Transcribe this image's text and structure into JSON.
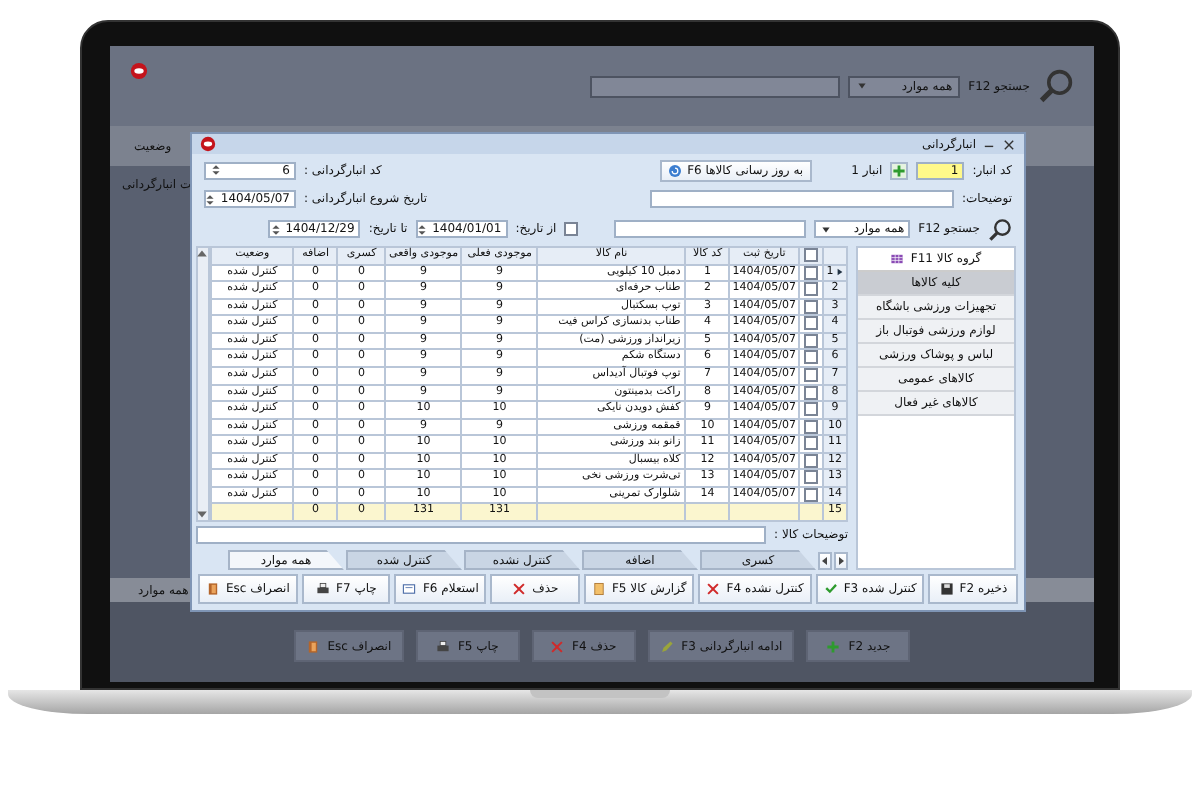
{
  "top_bar": {
    "search_label": "جستجو F12",
    "filter": "همه موارد"
  },
  "background_list": {
    "column_header": "وضعیت",
    "row": "ت انبارگردانی",
    "tab": "همه موارد"
  },
  "background_buttons": [
    {
      "kind": "new",
      "label": "جدید F2"
    },
    {
      "kind": "continue",
      "label": "ادامه انبارگردانی F3"
    },
    {
      "kind": "delete",
      "label": "حذف F4"
    },
    {
      "kind": "print",
      "label": "چاپ F5"
    },
    {
      "kind": "cancel",
      "label": "انصراف Esc"
    }
  ],
  "dialog": {
    "title": "انبارگردانی",
    "warehouse": {
      "label": "کد انبار:",
      "code": "1",
      "name": "انبار 1"
    },
    "update_button": "به روز رسانی کالاها F6",
    "count_code": {
      "label": "کد انبارگردانی :",
      "value": "6"
    },
    "description": {
      "label": "توضیحات:"
    },
    "start_date": {
      "label": "تاریخ شروع انبارگردانی :",
      "value": "1404/05/07"
    },
    "search": {
      "label": "جستجو F12",
      "filter": "همه موارد"
    },
    "date_filter": {
      "checked": false,
      "from_label": "از تاریخ:",
      "from": "1404/01/01",
      "to_label": "تا تاریخ:",
      "to": "1404/12/29"
    },
    "groups": {
      "title": "گروه کالا F11",
      "items": [
        {
          "label": "کلیه کالاها",
          "selected": true
        },
        {
          "label": "تجهیزات ورزشی باشگاه",
          "selected": false
        },
        {
          "label": "لوازم ورزشی فوتبال باز",
          "selected": false
        },
        {
          "label": "لباس و پوشاک ورزشی",
          "selected": false
        },
        {
          "label": "کالاهای عمومی",
          "selected": false
        },
        {
          "label": "کالاهای غیر فعال",
          "selected": false
        }
      ]
    },
    "table": {
      "select_all_checked": false,
      "columns": [
        "تاریخ ثبت",
        "کد کالا",
        "نام کالا",
        "موجودی فعلی",
        "موجودی واقعی",
        "کسری",
        "اضافه",
        "وضعیت"
      ],
      "rows": [
        {
          "number": "1",
          "current": true,
          "checked": false,
          "date": "1404/05/07",
          "code": "1",
          "name": "دمبل 10 کیلویی",
          "stock": "9",
          "actual": "9",
          "shortage": "0",
          "surplus": "0",
          "status": "کنترل شده"
        },
        {
          "number": "2",
          "current": false,
          "checked": false,
          "date": "1404/05/07",
          "code": "2",
          "name": "طناب حرفه‌ای",
          "stock": "9",
          "actual": "9",
          "shortage": "0",
          "surplus": "0",
          "status": "کنترل شده"
        },
        {
          "number": "3",
          "current": false,
          "checked": false,
          "date": "1404/05/07",
          "code": "3",
          "name": "توپ بسکتبال",
          "stock": "9",
          "actual": "9",
          "shortage": "0",
          "surplus": "0",
          "status": "کنترل شده"
        },
        {
          "number": "4",
          "current": false,
          "checked": false,
          "date": "1404/05/07",
          "code": "4",
          "name": "طناب بدنسازی کراس فیت",
          "stock": "9",
          "actual": "9",
          "shortage": "0",
          "surplus": "0",
          "status": "کنترل شده"
        },
        {
          "number": "5",
          "current": false,
          "checked": false,
          "date": "1404/05/07",
          "code": "5",
          "name": "زیرانداز ورزشی (مت)",
          "stock": "9",
          "actual": "9",
          "shortage": "0",
          "surplus": "0",
          "status": "کنترل شده"
        },
        {
          "number": "6",
          "current": false,
          "checked": false,
          "date": "1404/05/07",
          "code": "6",
          "name": "دستگاه شکم",
          "stock": "9",
          "actual": "9",
          "shortage": "0",
          "surplus": "0",
          "status": "کنترل شده"
        },
        {
          "number": "7",
          "current": false,
          "checked": false,
          "date": "1404/05/07",
          "code": "7",
          "name": "توپ فوتبال آدیداس",
          "stock": "9",
          "actual": "9",
          "shortage": "0",
          "surplus": "0",
          "status": "کنترل شده"
        },
        {
          "number": "8",
          "current": false,
          "checked": false,
          "date": "1404/05/07",
          "code": "8",
          "name": "راکت بدمینتون",
          "stock": "9",
          "actual": "9",
          "shortage": "0",
          "surplus": "0",
          "status": "کنترل شده"
        },
        {
          "number": "9",
          "current": false,
          "checked": false,
          "date": "1404/05/07",
          "code": "9",
          "name": "کفش دویدن نایکی",
          "stock": "10",
          "actual": "10",
          "shortage": "0",
          "surplus": "0",
          "status": "کنترل شده"
        },
        {
          "number": "10",
          "current": false,
          "checked": false,
          "date": "1404/05/07",
          "code": "10",
          "name": "قمقمه ورزشی",
          "stock": "9",
          "actual": "9",
          "shortage": "0",
          "surplus": "0",
          "status": "کنترل شده"
        },
        {
          "number": "11",
          "current": false,
          "checked": false,
          "date": "1404/05/07",
          "code": "11",
          "name": "زانو بند ورزشی",
          "stock": "10",
          "actual": "10",
          "shortage": "0",
          "surplus": "0",
          "status": "کنترل شده"
        },
        {
          "number": "12",
          "current": false,
          "checked": false,
          "date": "1404/05/07",
          "code": "12",
          "name": "کلاه بیسبال",
          "stock": "10",
          "actual": "10",
          "shortage": "0",
          "surplus": "0",
          "status": "کنترل شده"
        },
        {
          "number": "13",
          "current": false,
          "checked": false,
          "date": "1404/05/07",
          "code": "13",
          "name": "تی‌شرت ورزشی نخی",
          "stock": "10",
          "actual": "10",
          "shortage": "0",
          "surplus": "0",
          "status": "کنترل شده"
        },
        {
          "number": "14",
          "current": false,
          "checked": false,
          "date": "1404/05/07",
          "code": "14",
          "name": "شلوارک تمرینی",
          "stock": "10",
          "actual": "10",
          "shortage": "0",
          "surplus": "0",
          "status": "کنترل شده"
        }
      ],
      "totals": {
        "number": "15",
        "stock": "131",
        "actual": "131",
        "shortage": "0",
        "surplus": "0"
      }
    },
    "item_description_label": "توضیحات کالا :",
    "tabs": [
      {
        "label": "کسری",
        "selected": false
      },
      {
        "label": "اضافه",
        "selected": false
      },
      {
        "label": "کنترل نشده",
        "selected": false
      },
      {
        "label": "کنترل شده",
        "selected": false
      },
      {
        "label": "همه موارد",
        "selected": true
      }
    ],
    "buttons": [
      {
        "kind": "save",
        "label": "ذخیره F2"
      },
      {
        "kind": "mark_checked",
        "label": "کنترل شده F3"
      },
      {
        "kind": "mark_unchecked",
        "label": "کنترل نشده F4"
      },
      {
        "kind": "report",
        "label": "گزارش کالا F5"
      },
      {
        "kind": "delete",
        "label": "حذف"
      },
      {
        "kind": "inquiry",
        "label": "استعلام F6"
      },
      {
        "kind": "print",
        "label": "چاپ F7"
      },
      {
        "kind": "cancel",
        "label": "انصراف Esc"
      }
    ]
  }
}
